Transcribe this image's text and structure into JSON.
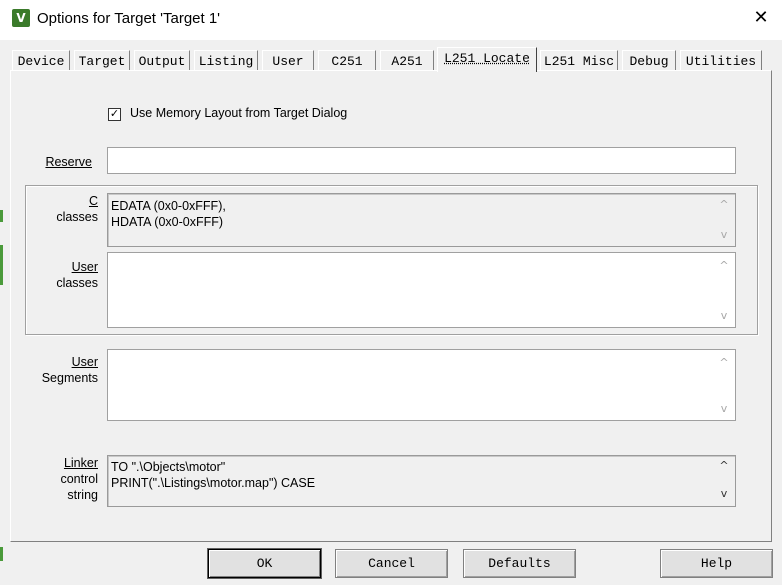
{
  "window": {
    "title": "Options for Target 'Target 1'",
    "app_icon": "uvision-icon",
    "close_glyph": "✕"
  },
  "tabs": [
    {
      "label": "Device",
      "active": false
    },
    {
      "label": "Target",
      "active": false
    },
    {
      "label": "Output",
      "active": false
    },
    {
      "label": "Listing",
      "active": false
    },
    {
      "label": "User",
      "active": false
    },
    {
      "label": "C251",
      "active": false
    },
    {
      "label": "A251",
      "active": false
    },
    {
      "label": "L251 Locate",
      "active": true
    },
    {
      "label": "L251 Misc",
      "active": false
    },
    {
      "label": "Debug",
      "active": false
    },
    {
      "label": "Utilities",
      "active": false
    }
  ],
  "locate": {
    "use_memory_layout": {
      "checked": true,
      "label": "Use Memory Layout from Target Dialog"
    },
    "reserve": {
      "label": "Reserve",
      "value": ""
    },
    "c_classes": {
      "label_line1": "C",
      "label_line2": "classes",
      "lines": [
        "EDATA (0x0-0xFFF),",
        "HDATA (0x0-0xFFF)"
      ]
    },
    "user_classes": {
      "label_line1": "User",
      "label_line2": "classes",
      "value": ""
    },
    "user_segments": {
      "label_line1": "User",
      "label_line2": "Segments",
      "value": ""
    },
    "linker_control": {
      "label_line1": "Linker",
      "label_line2": "control",
      "label_line3": "string",
      "lines": [
        "TO \".\\Objects\\motor\"",
        "PRINT(\".\\Listings\\motor.map\") CASE"
      ]
    }
  },
  "buttons": {
    "ok": "OK",
    "cancel": "Cancel",
    "defaults": "Defaults",
    "help": "Help"
  },
  "icons": {
    "scroll_up": "^",
    "scroll_down": "v",
    "check": "✓"
  }
}
